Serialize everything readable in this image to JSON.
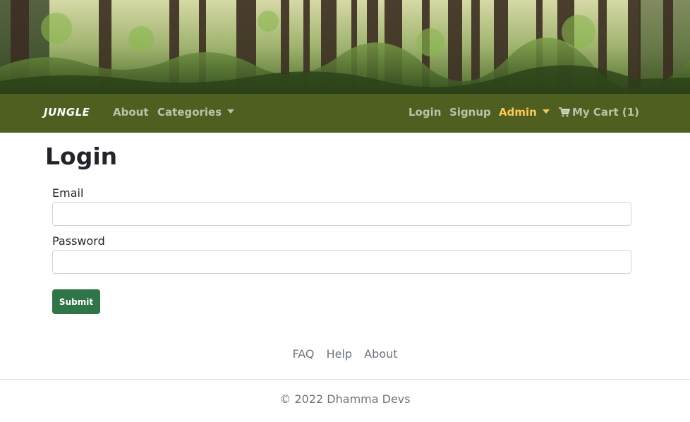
{
  "colors": {
    "navbar_bg": "#4f5f1f",
    "nav_link": "#c8ccb9",
    "nav_active": "#ffc95a",
    "submit_bg": "#2f7548"
  },
  "navbar": {
    "brand": "JUNGLE",
    "left_links": [
      {
        "label": "About"
      },
      {
        "label": "Categories",
        "dropdown": true
      }
    ],
    "right_links": [
      {
        "label": "Login"
      },
      {
        "label": "Signup"
      },
      {
        "label": "Admin",
        "dropdown": true,
        "active": true
      },
      {
        "label": "My Cart (1)",
        "icon": "shopping-cart-icon"
      }
    ]
  },
  "form": {
    "title": "Login",
    "email_label": "Email",
    "email_value": "",
    "password_label": "Password",
    "password_value": "",
    "submit_label": "Submit"
  },
  "footer": {
    "links": [
      "FAQ",
      "Help",
      "About"
    ],
    "copyright": "© 2022 Dhamma Devs"
  }
}
